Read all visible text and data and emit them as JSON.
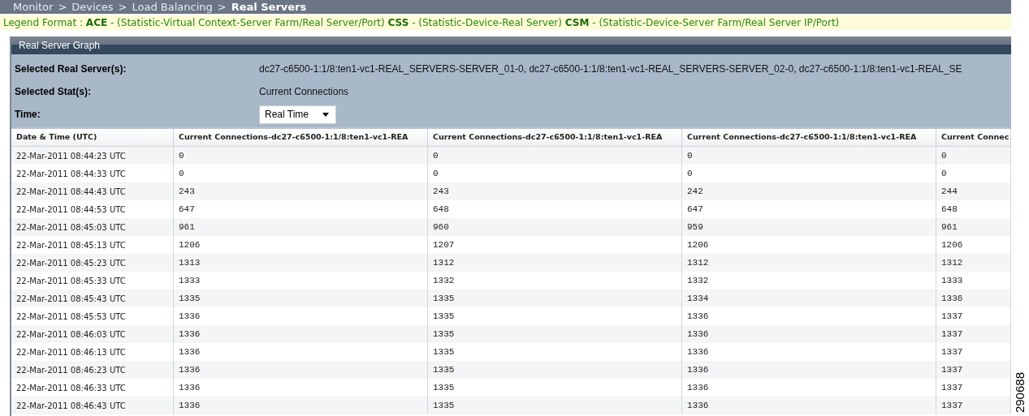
{
  "breadcrumb": [
    {
      "label": "Monitor",
      "kind": "link"
    },
    {
      "label": ">",
      "kind": "separator"
    },
    {
      "label": "Devices",
      "kind": "link"
    },
    {
      "label": ">",
      "kind": "separator"
    },
    {
      "label": "Load Balancing",
      "kind": "link"
    },
    {
      "label": ">",
      "kind": "separator"
    },
    {
      "label": "Real Servers",
      "kind": "current"
    }
  ],
  "legend": "Legend Format : **ACE** - (Statistic-Virtual Context-Server Farm/Real Server/Port) **CSS** - (Statistic-Device-Real Server) **CSM** - (Statistic-Device-Server Farm/Real Server IP/Port)",
  "panel": {
    "title": "Real Server Graph",
    "fields": [
      {
        "label": "Selected Real Server(s):",
        "kind": "text",
        "value": "dc27-c6500-1:1/8:ten1-vc1-REAL_SERVERS-SERVER_01-0, dc27-c6500-1:1/8:ten1-vc1-REAL_SERVERS-SERVER_02-0, dc27-c6500-1:1/8:ten1-vc1-REAL_SE"
      },
      {
        "label": "Selected Stat(s):",
        "kind": "text",
        "value": "Current Connections"
      },
      {
        "label": "Time:",
        "kind": "select",
        "value": "Real Time"
      }
    ]
  },
  "table": {
    "columns": [
      "Date & Time (UTC)",
      "Current Connections-dc27-c6500-1:1/8:ten1-vc1-REA",
      "Current Connections-dc27-c6500-1:1/8:ten1-vc1-REA",
      "Current Connections-dc27-c6500-1:1/8:ten1-vc1-REA",
      "Current Connec"
    ],
    "rows": [
      [
        "22-Mar-2011 08:44:23 UTC",
        "0",
        "0",
        "0",
        "0"
      ],
      [
        "22-Mar-2011 08:44:33 UTC",
        "0",
        "0",
        "0",
        "0"
      ],
      [
        "22-Mar-2011 08:44:43 UTC",
        "243",
        "243",
        "242",
        "244"
      ],
      [
        "22-Mar-2011 08:44:53 UTC",
        "647",
        "648",
        "647",
        "648"
      ],
      [
        "22-Mar-2011 08:45:03 UTC",
        "961",
        "960",
        "959",
        "961"
      ],
      [
        "22-Mar-2011 08:45:13 UTC",
        "1206",
        "1207",
        "1206",
        "1206"
      ],
      [
        "22-Mar-2011 08:45:23 UTC",
        "1313",
        "1312",
        "1312",
        "1312"
      ],
      [
        "22-Mar-2011 08:45:33 UTC",
        "1333",
        "1332",
        "1332",
        "1333"
      ],
      [
        "22-Mar-2011 08:45:43 UTC",
        "1335",
        "1335",
        "1334",
        "1336"
      ],
      [
        "22-Mar-2011 08:45:53 UTC",
        "1336",
        "1335",
        "1336",
        "1337"
      ],
      [
        "22-Mar-2011 08:46:03 UTC",
        "1336",
        "1335",
        "1336",
        "1337"
      ],
      [
        "22-Mar-2011 08:46:13 UTC",
        "1336",
        "1335",
        "1336",
        "1337"
      ],
      [
        "22-Mar-2011 08:46:23 UTC",
        "1336",
        "1335",
        "1336",
        "1337"
      ],
      [
        "22-Mar-2011 08:46:33 UTC",
        "1336",
        "1335",
        "1336",
        "1337"
      ],
      [
        "22-Mar-2011 08:46:43 UTC",
        "1336",
        "1335",
        "1336",
        "1337"
      ]
    ]
  },
  "figure_number": "290688"
}
